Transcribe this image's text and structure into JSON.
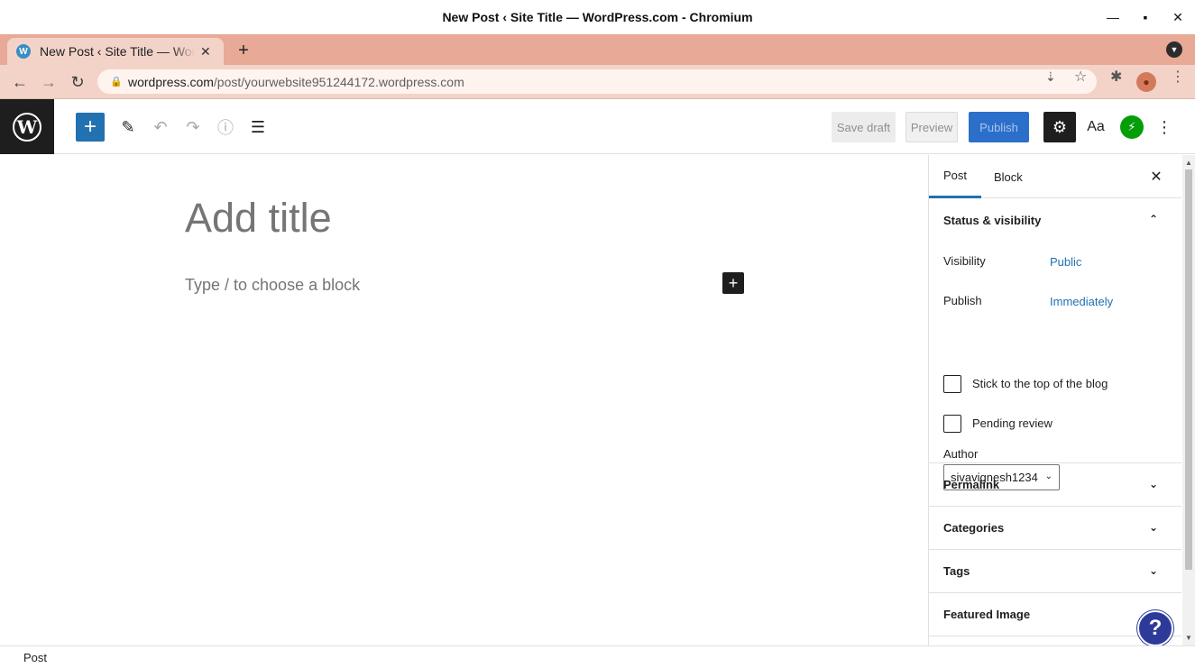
{
  "window": {
    "title": "New Post ‹ Site Title — WordPress.com - Chromium",
    "minimize_icon": "minimize-icon",
    "maximize_icon": "maximize-icon",
    "close_icon": "close-icon"
  },
  "browser": {
    "tab_title": "New Post ‹ Site Title — WordPress.com",
    "url_host": "wordpress.com",
    "url_path": "/post/yourwebsite951244172.wordpress.com"
  },
  "editor_header": {
    "save_draft": "Save draft",
    "preview": "Preview",
    "publish": "Publish",
    "styles_label": "Aa"
  },
  "canvas": {
    "title_placeholder": "Add title",
    "block_placeholder": "Type / to choose a block"
  },
  "sidebar": {
    "tabs": [
      {
        "label": "Post",
        "active": true
      },
      {
        "label": "Block",
        "active": false
      }
    ],
    "status_visibility": {
      "heading": "Status & visibility",
      "visibility_label": "Visibility",
      "visibility_value": "Public",
      "publish_label": "Publish",
      "publish_value": "Immediately",
      "sticky_label": "Stick to the top of the blog",
      "pending_label": "Pending review",
      "author_label": "Author",
      "author_value": "sivavignesh1234"
    },
    "panels": [
      {
        "label": "Permalink"
      },
      {
        "label": "Categories"
      },
      {
        "label": "Tags"
      },
      {
        "label": "Featured Image"
      }
    ]
  },
  "footer": {
    "breadcrumb": "Post"
  },
  "colors": {
    "accent": "#2271b1",
    "tab_strip": "#e8a996",
    "toolbar": "#f3d3c8",
    "jetpack": "#069e08",
    "help": "#2d3a9a"
  }
}
